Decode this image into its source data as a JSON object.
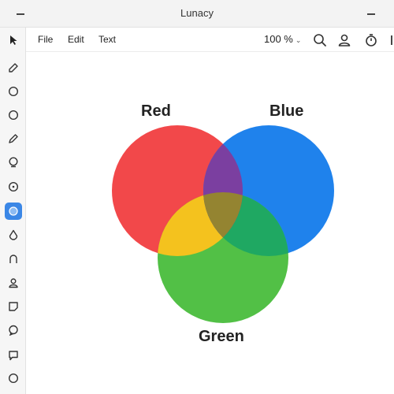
{
  "window": {
    "title": "Lunacy"
  },
  "menu": {
    "file": "File",
    "edit": "Edit",
    "text": "Text"
  },
  "zoom": {
    "value": "100 %"
  },
  "toolbar_icons": [
    "pointer-icon",
    "pencil-icon",
    "circle-icon",
    "circle-icon",
    "pen-icon",
    "lasso-icon",
    "target-icon",
    "circle-fill-icon",
    "drop-icon",
    "speech-icon",
    "user-icon",
    "note-icon",
    "bubble-icon",
    "comment-icon",
    "circle-icon"
  ],
  "venn": {
    "labels": {
      "red": "Red",
      "blue": "Blue",
      "green": "Green"
    },
    "colors": {
      "red": "#f2484a",
      "blue": "#1f82ec",
      "green": "#52c046",
      "yellow": "#f4c21e",
      "purple": "#7b3fa0",
      "olive": "#948431",
      "teal": "#1fa862"
    }
  }
}
